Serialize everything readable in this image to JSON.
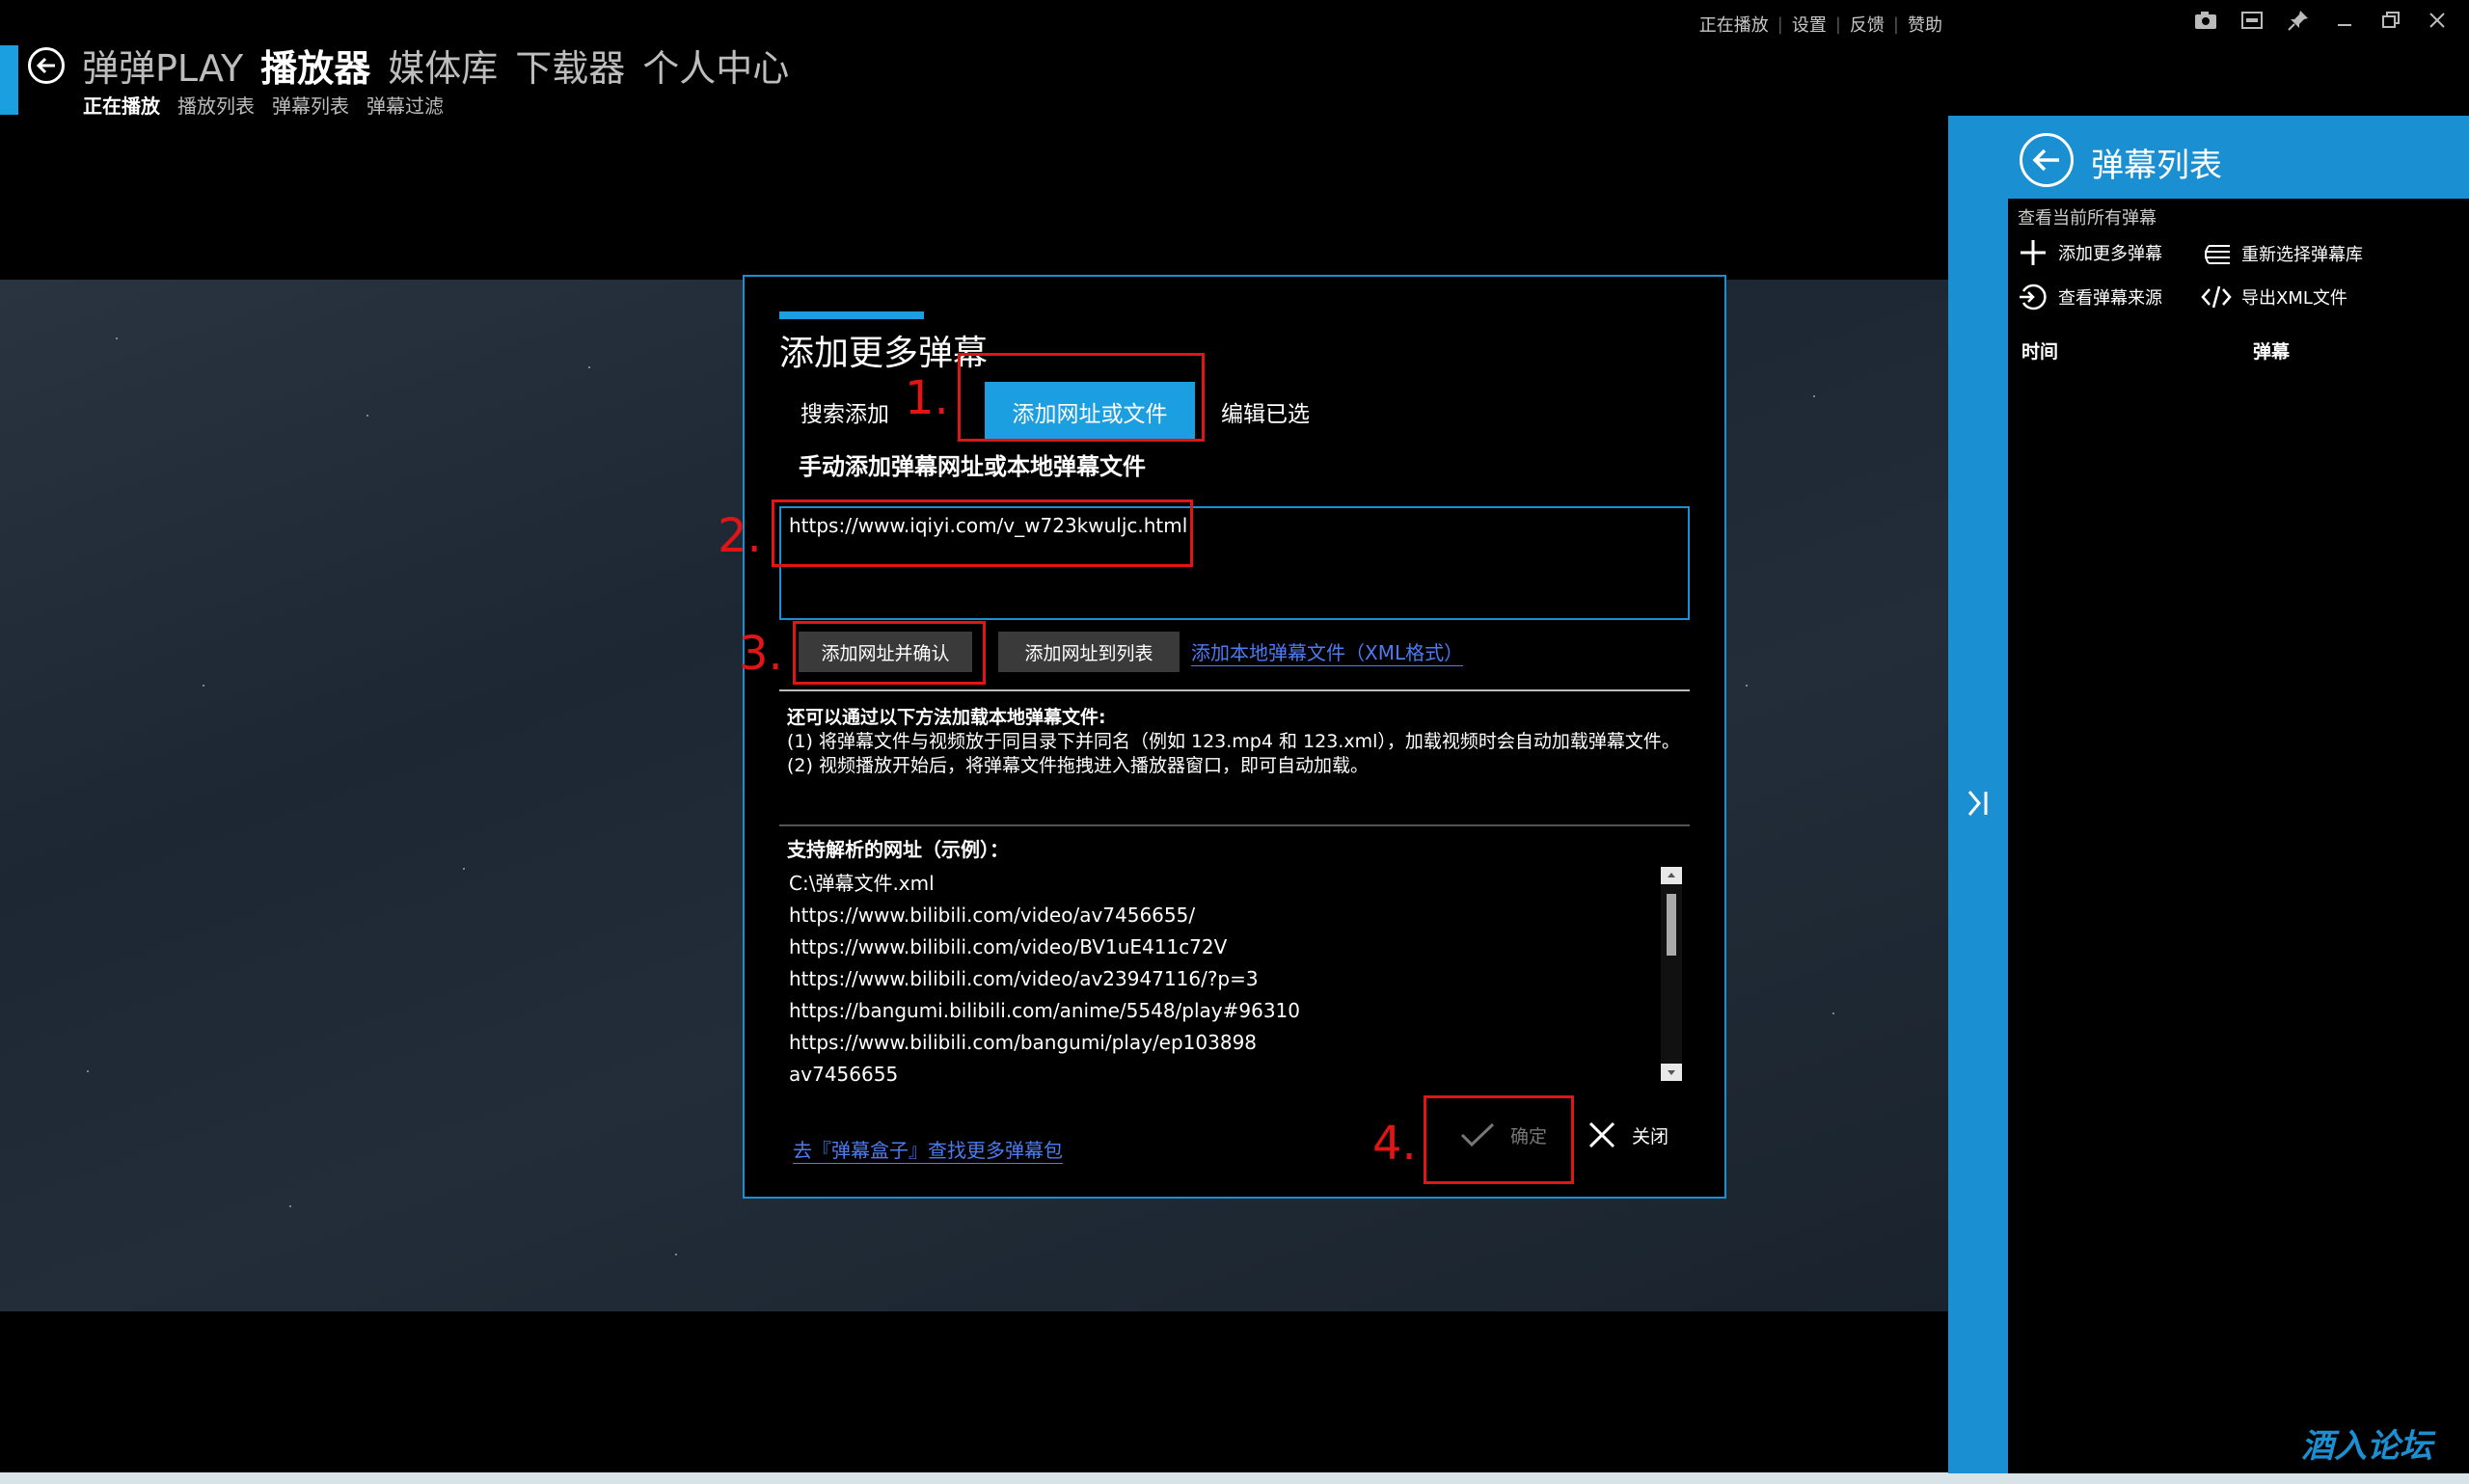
{
  "nav": {
    "main": [
      "弹弹PLAY",
      "播放器",
      "媒体库",
      "下载器",
      "个人中心"
    ],
    "sub": [
      "正在播放",
      "播放列表",
      "弹幕列表",
      "弹幕过滤"
    ]
  },
  "top_links": [
    "正在播放",
    "设置",
    "反馈",
    "赞助"
  ],
  "dialog": {
    "title": "添加更多弹幕",
    "tabs": {
      "search": "搜索添加",
      "add_url": "添加网址或文件",
      "edit": "编辑已选"
    },
    "section_title": "手动添加弹幕网址或本地弹幕文件",
    "url_value": "https://www.iqiyi.com/v_w723kwuljc.html",
    "btn_add_confirm": "添加网址并确认",
    "btn_add_list": "添加网址到列表",
    "link_local_xml": "添加本地弹幕文件（XML格式）",
    "info_title": "还可以通过以下方法加载本地弹幕文件:",
    "info_lines": [
      "(1) 将弹幕文件与视频放于同目录下并同名（例如 123.mp4 和 123.xml），加载视频时会自动加载弹幕文件。",
      "(2) 视频播放开始后，将弹幕文件拖拽进入播放器窗口，即可自动加载。"
    ],
    "support_title": "支持解析的网址（示例）：",
    "examples": [
      "C:\\弹幕文件.xml",
      "https://www.bilibili.com/video/av7456655/",
      "https://www.bilibili.com/video/BV1uE411c72V",
      "https://www.bilibili.com/video/av23947116/?p=3",
      "https://bangumi.bilibili.com/anime/5548/play#96310",
      "https://www.bilibili.com/bangumi/play/ep103898",
      "av7456655"
    ],
    "more_link": "去『弹幕盒子』查找更多弹幕包",
    "ok_label": "确定",
    "close_label": "关闭"
  },
  "annotations": {
    "n1": "1.",
    "n2": "2.",
    "n3": "3.",
    "n4": "4."
  },
  "right_panel": {
    "title": "弹幕列表",
    "desc": "查看当前所有弹幕",
    "actions": {
      "add_more": "添加更多弹幕",
      "reselect": "重新选择弹幕库",
      "view_source": "查看弹幕来源",
      "export_xml": "导出XML文件"
    },
    "col_time": "时间",
    "col_danmaku": "弹幕"
  },
  "watermark": "酒入论坛",
  "colors": {
    "accent": "#1c9fe0",
    "panel": "#1a8fd2",
    "annotation": "#e01515",
    "link": "#4d7bf2"
  }
}
